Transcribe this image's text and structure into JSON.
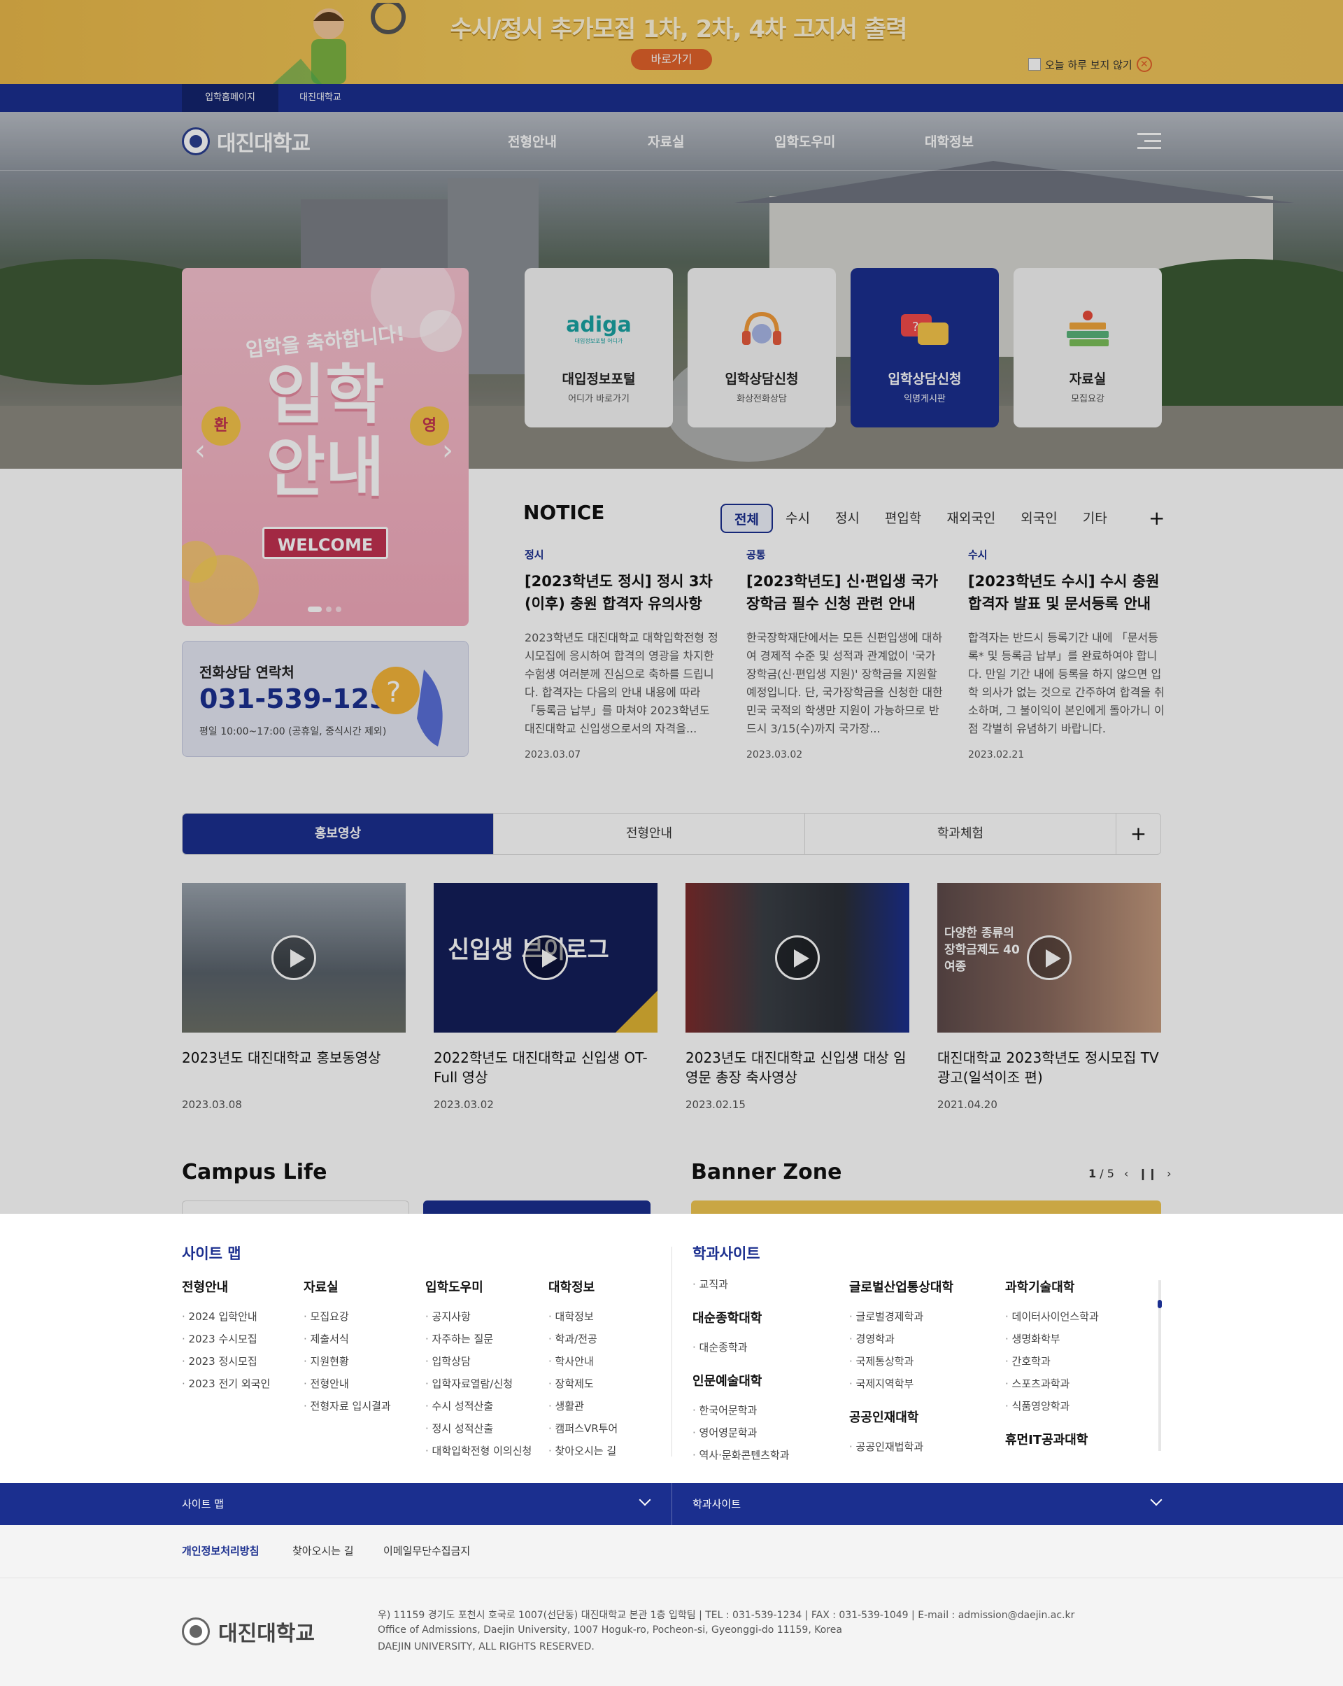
{
  "top_banner": {
    "title": "수시/정시 추가모집 1차, 2차, 4차 고지서 출력",
    "button": "바로가기",
    "dismiss_label": "오늘 하루 보지 않기"
  },
  "util_nav": {
    "home": "입학홈페이지",
    "univ": "대진대학교"
  },
  "header": {
    "logo": "대진대학교",
    "menu": [
      "전형안내",
      "자료실",
      "입학도우미",
      "대학정보"
    ]
  },
  "poster": {
    "subtitle": "입학을 축하합니다!",
    "title_line1": "입학",
    "title_line2": "안내",
    "badge_left": "환",
    "badge_right": "영",
    "welcome": "WELCOME"
  },
  "quick_links": [
    {
      "logo": "adiga",
      "logo_sub": "대입정보포털 어디가",
      "title": "대입정보포털",
      "sub": "어디가 바로가기",
      "icon": "adiga-logo",
      "active": false
    },
    {
      "title": "입학상담신청",
      "sub": "화상전화상담",
      "icon": "headset-icon",
      "active": false
    },
    {
      "title": "입학상담신청",
      "sub": "익명게시판",
      "icon": "chat-bubbles-icon",
      "active": true
    },
    {
      "title": "자료실",
      "sub": "모집요강",
      "icon": "books-icon",
      "active": false
    }
  ],
  "phone": {
    "label": "전화상담 연락처",
    "number": "031-539-1234",
    "hours": "평일 10:00~17:00 (공휴일, 중식시간 제외)"
  },
  "notice": {
    "title": "NOTICE",
    "tabs": [
      "전체",
      "수시",
      "정시",
      "편입학",
      "재외국인",
      "외국인",
      "기타"
    ],
    "active_tab": 0,
    "items": [
      {
        "category": "정시",
        "title": "[2023학년도 정시] 정시 3차(이후) 충원 합격자 유의사항",
        "body": "2023학년도 대진대학교 대학입학전형 정시모집에 응시하여 합격의 영광을 차지한 수험생 여러분께 진심으로 축하를 드립니다. 합격자는 다음의 안내 내용에 따라 「등록금 납부」를 마쳐야 2023학년도 대진대학교 신입생으로서의 자격을...",
        "date": "2023.03.07"
      },
      {
        "category": "공통",
        "title": "[2023학년도] 신·편입생 국가장학금 필수 신청 관련 안내",
        "body": "한국장학재단에서는 모든 신편입생에 대하여 경제적 수준 및 성적과 관계없이 '국가장학금(신·편입생 지원)' 장학금을 지원할 예정입니다. 단, 국가장학금을 신청한 대한민국 국적의 학생만 지원이 가능하므로 반드시 3/15(수)까지 국가장...",
        "date": "2023.03.02"
      },
      {
        "category": "수시",
        "title": "[2023학년도 수시] 수시 충원합격자 발표 및 문서등록 안내",
        "body": "합격자는 반드시 등록기간 내에 「문서등록* 및 등록금 납부」를 완료하여야 합니다. 만일 기간 내에 등록을 하지 않으면 입학 의사가 없는 것으로 간주하여 합격을 취소하며, 그 불이익이 본인에게 돌아가니 이점 각별히 유념하기 바랍니다.",
        "date": "2023.02.21"
      }
    ]
  },
  "video": {
    "tabs": [
      "홍보영상",
      "전형안내",
      "학과체험"
    ],
    "active_tab": 0,
    "items": [
      {
        "title": "2023년도 대진대학교 홍보동영상",
        "date": "2023.03.08",
        "thumb_color": "#5b6774"
      },
      {
        "title": "2022학년도 대진대학교 신입생 OT- Full 영상",
        "date": "2023.03.02",
        "thumb_color": "#141e5a",
        "thumb_text": "신입생 브이로그"
      },
      {
        "title": "2023년도 대진대학교 신입생 대상 임영문 총장 축사영상",
        "date": "2023.02.15",
        "thumb_color": "#3a3f46"
      },
      {
        "title": "대진대학교 2023학년도 정시모집 TV광고(일석이조 편)",
        "date": "2021.04.20",
        "thumb_color": "#6a4a44",
        "thumb_text": "다양한 종류의 장학금제도 40여종"
      }
    ]
  },
  "campus": {
    "title": "Campus Life"
  },
  "banner_zone": {
    "title": "Banner Zone",
    "current": "1",
    "total": "5"
  },
  "sitemap": {
    "title": "사이트 맵",
    "columns": [
      {
        "title": "전형안내",
        "items": [
          "2024 입학안내",
          "2023 수시모집",
          "2023 정시모집",
          "2023 전기 외국인"
        ]
      },
      {
        "title": "자료실",
        "items": [
          "모집요강",
          "제출서식",
          "지원현황",
          "전형안내",
          "전형자료 입시결과"
        ]
      },
      {
        "title": "입학도우미",
        "items": [
          "공지사항",
          "자주하는 질문",
          "입학상담",
          "입학자료열람/신청",
          "수시 성적산출",
          "정시 성적산출",
          "대학입학전형 이의신청"
        ]
      },
      {
        "title": "대학정보",
        "items": [
          "대학정보",
          "학과/전공",
          "학사안내",
          "장학제도",
          "생활관",
          "캠퍼스VR투어",
          "찾아오시는 길"
        ]
      }
    ]
  },
  "dept_sites": {
    "title": "학과사이트",
    "groups": [
      {
        "title": "",
        "items": [
          "교직과"
        ]
      },
      {
        "title": "대순종학대학",
        "items": [
          "대순종학과"
        ]
      },
      {
        "title": "인문예술대학",
        "items": [
          "한국어문학과",
          "영어영문학과",
          "역사·문화콘텐츠학과"
        ]
      },
      {
        "title": "글로벌산업통상대학",
        "items": [
          "글로벌경제학과",
          "경영학과",
          "국제통상학과",
          "국제지역학부"
        ]
      },
      {
        "title": "공공인재대학",
        "items": [
          "공공인재법학과"
        ]
      },
      {
        "title": "과학기술대학",
        "items": [
          "데이터사이언스학과",
          "생명화학부",
          "간호학과",
          "스포츠과학과",
          "식품영양학과"
        ]
      },
      {
        "title": "휴먼IT공과대학",
        "items": []
      }
    ]
  },
  "footer": {
    "bar_left": "사이트 맵",
    "bar_right": "학과사이트",
    "links": [
      "개인정보처리방침",
      "찾아오시는 길",
      "이메일무단수집금지"
    ],
    "logo": "대진대학교",
    "address": "우) 11159 경기도 포천시 호국로 1007(선단동) 대진대학교 본관 1층 입학팀  |  TEL : 031-539-1234  |  FAX : 031-539-1049  |  E-mail : admission@daejin.ac.kr",
    "address_en": "Office of Admissions, Daejin University, 1007 Hoguk-ro, Pocheon-si, Gyeonggi-do 11159, Korea",
    "copyright": "DAEJIN UNIVERSITY, ALL RIGHTS RESERVED."
  },
  "colors": {
    "primary": "#1b2f8f",
    "banner_yellow": "#f0c14f",
    "accent_orange": "#e2622a",
    "poster_pink": "#f3b3c2"
  }
}
